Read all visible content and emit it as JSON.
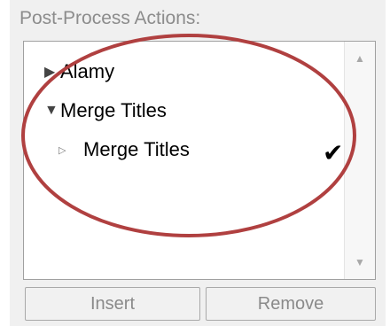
{
  "group": {
    "label": "Post-Process Actions:"
  },
  "tree": {
    "items": [
      {
        "label": "Alamy",
        "state": "collapsed"
      },
      {
        "label": "Merge Titles",
        "state": "expanded"
      },
      {
        "label": "Merge Titles",
        "state": "child",
        "checked": true
      }
    ]
  },
  "buttons": {
    "insert": "Insert",
    "remove": "Remove"
  },
  "icons": {
    "collapsed_arrow": "triangle-right-icon",
    "expanded_arrow": "triangle-down-icon",
    "child_arrow": "small-triangle-right-icon",
    "check": "checkmark-icon"
  },
  "colors": {
    "annotation_circle": "#b04040"
  }
}
